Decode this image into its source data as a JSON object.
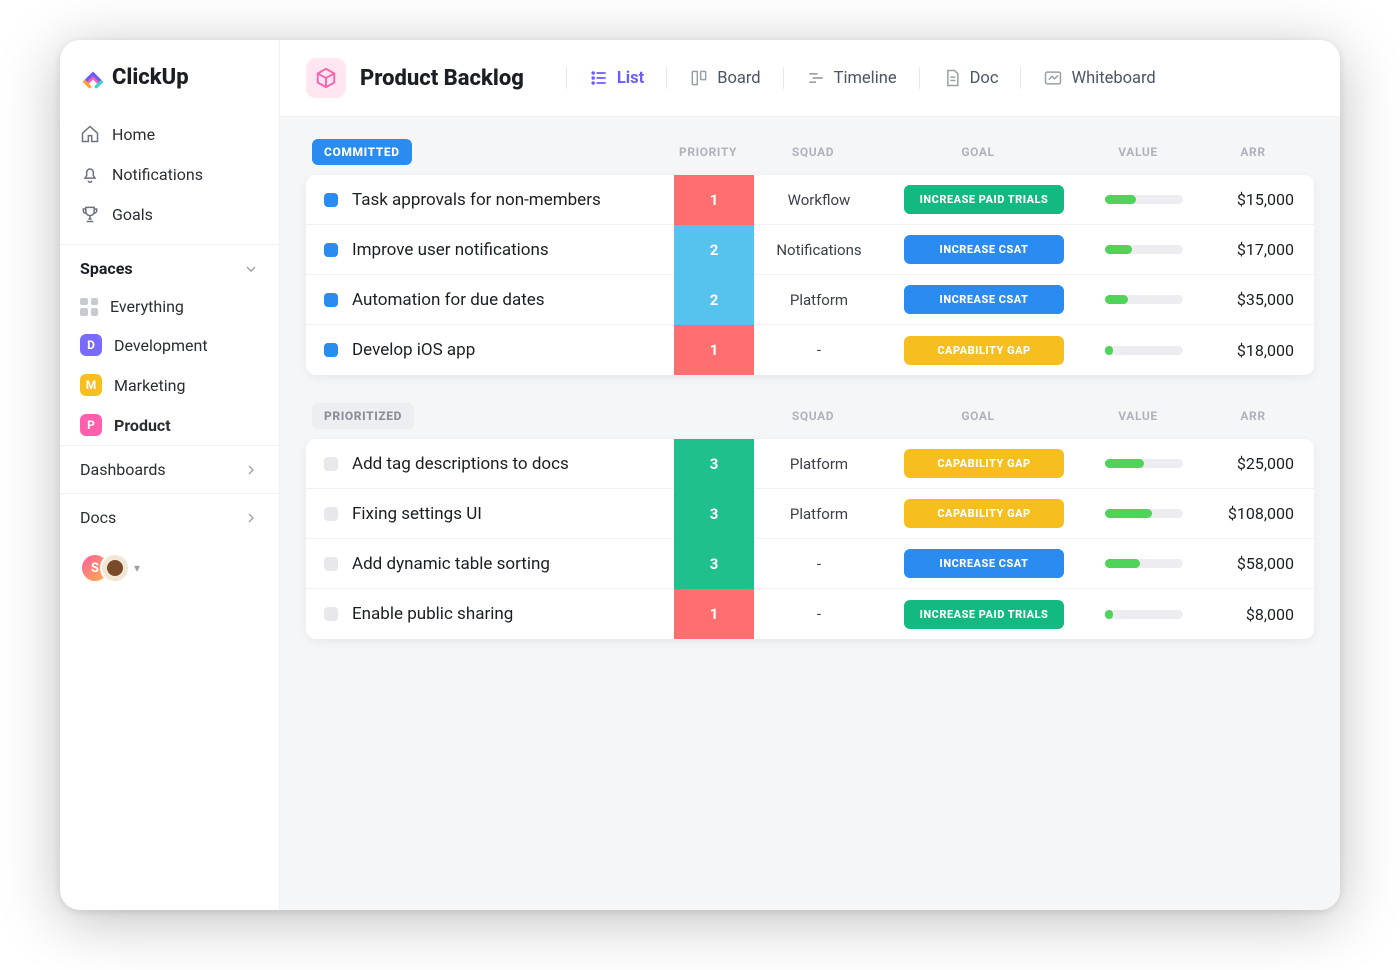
{
  "brand": {
    "name": "ClickUp"
  },
  "sidebar": {
    "nav": [
      {
        "label": "Home"
      },
      {
        "label": "Notifications"
      },
      {
        "label": "Goals"
      }
    ],
    "spaces_label": "Spaces",
    "everything_label": "Everything",
    "spaces": [
      {
        "letter": "D",
        "label": "Development",
        "color": "#7a6bff"
      },
      {
        "letter": "M",
        "label": "Marketing",
        "color": "#f6bf1f"
      },
      {
        "letter": "P",
        "label": "Product",
        "color": "#ff5fad",
        "active": true
      }
    ],
    "bottom": [
      {
        "label": "Dashboards"
      },
      {
        "label": "Docs"
      }
    ],
    "avatars": {
      "initial": "S"
    }
  },
  "header": {
    "title": "Product Backlog",
    "tabs": [
      {
        "label": "List",
        "active": true
      },
      {
        "label": "Board"
      },
      {
        "label": "Timeline"
      },
      {
        "label": "Doc"
      },
      {
        "label": "Whiteboard"
      }
    ]
  },
  "columns": {
    "priority": "PRIORITY",
    "squad": "SQUAD",
    "goal": "GOAL",
    "value": "VALUE",
    "arr": "ARR"
  },
  "groups": [
    {
      "name": "COMMITTED",
      "chip_style": "blue",
      "show_priority_header": true,
      "status_style": "blue",
      "tasks": [
        {
          "title": "Task approvals for non-members",
          "priority": "1",
          "prio_style": "p1",
          "squad": "Workflow",
          "goal": "INCREASE PAID TRIALS",
          "goal_style": "green",
          "value_pct": 40,
          "arr": "$15,000"
        },
        {
          "title": "Improve  user notifications",
          "priority": "2",
          "prio_style": "p2",
          "squad": "Notifications",
          "goal": "INCREASE CSAT",
          "goal_style": "blue",
          "value_pct": 35,
          "arr": "$17,000"
        },
        {
          "title": "Automation for due dates",
          "priority": "2",
          "prio_style": "p2",
          "squad": "Platform",
          "goal": "INCREASE CSAT",
          "goal_style": "blue",
          "value_pct": 30,
          "arr": "$35,000"
        },
        {
          "title": "Develop iOS app",
          "priority": "1",
          "prio_style": "p1",
          "squad": "-",
          "goal": "CAPABILITY GAP",
          "goal_style": "yellow",
          "value_pct": 10,
          "arr": "$18,000"
        }
      ]
    },
    {
      "name": "PRIORITIZED",
      "chip_style": "gray",
      "show_priority_header": false,
      "status_style": "gray",
      "tasks": [
        {
          "title": "Add tag descriptions to docs",
          "priority": "3",
          "prio_style": "p3",
          "squad": "Platform",
          "goal": "CAPABILITY GAP",
          "goal_style": "yellow",
          "value_pct": 50,
          "arr": "$25,000"
        },
        {
          "title": "Fixing settings UI",
          "priority": "3",
          "prio_style": "p3",
          "squad": "Platform",
          "goal": "CAPABILITY GAP",
          "goal_style": "yellow",
          "value_pct": 60,
          "arr": "$108,000"
        },
        {
          "title": "Add dynamic table sorting",
          "priority": "3",
          "prio_style": "p3",
          "squad": "-",
          "goal": "INCREASE CSAT",
          "goal_style": "blue",
          "value_pct": 45,
          "arr": "$58,000"
        },
        {
          "title": "Enable public sharing",
          "priority": "1",
          "prio_style": "p1",
          "squad": "-",
          "goal": "INCREASE PAID TRIALS",
          "goal_style": "green",
          "value_pct": 10,
          "arr": "$8,000"
        }
      ]
    }
  ]
}
